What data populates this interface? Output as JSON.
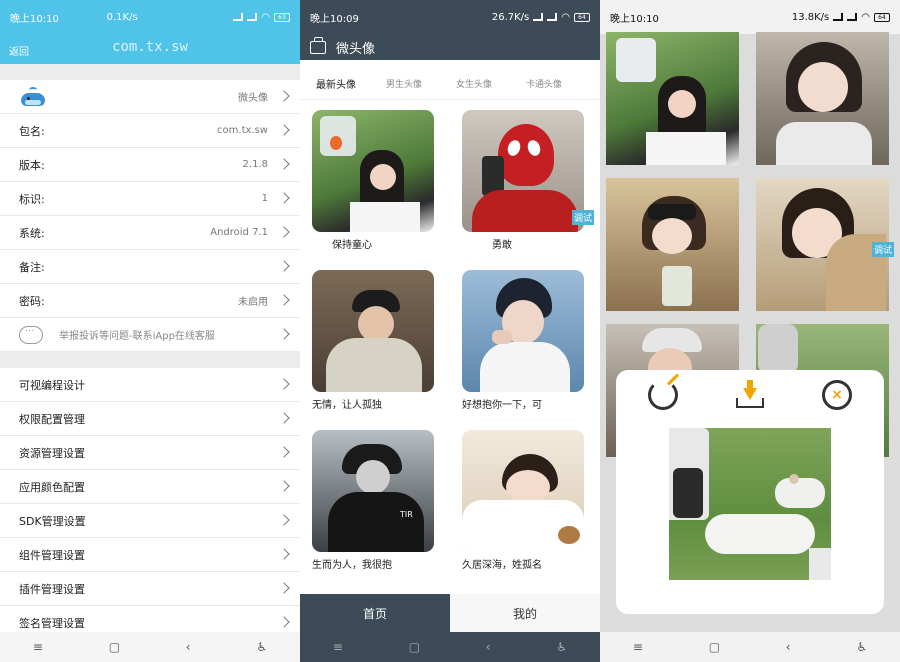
{
  "panel1": {
    "status": {
      "time": "晚上10:10",
      "speed": "0.1K/s",
      "battery": "63"
    },
    "back_label": "返回",
    "app_title": "com.tx.sw",
    "info_rows": [
      {
        "label": "",
        "value": "微头像",
        "icon": "whale-icon"
      },
      {
        "label": "包名:",
        "value": "com.tx.sw"
      },
      {
        "label": "版本:",
        "value": "2.1.8"
      },
      {
        "label": "标识:",
        "value": "1"
      },
      {
        "label": "系统:",
        "value": "Android 7.1"
      },
      {
        "label": "备注:",
        "value": ""
      },
      {
        "label": "密码:",
        "value": "未启用"
      }
    ],
    "complaint_text": "举报投诉等问题-联系iApp在线客服",
    "menu_rows": [
      "可视编程设计",
      "权限配置管理",
      "资源管理设置",
      "应用颜色配置",
      "SDK管理设置",
      "组件管理设置",
      "插件管理设置",
      "签名管理设置"
    ]
  },
  "panel2": {
    "status": {
      "time": "晚上10:09",
      "speed": "26.7K/s",
      "battery": "64"
    },
    "title": "微头像",
    "tabs": [
      "最新头像",
      "男生头像",
      "女生头像",
      "卡通头像"
    ],
    "cards": [
      {
        "caption": "保持童心"
      },
      {
        "caption": "勇敢"
      },
      {
        "caption": "无情，让人孤独"
      },
      {
        "caption": "好想抱你一下，可"
      },
      {
        "caption": "生而为人，我很抱"
      },
      {
        "caption": "久居深海，姓孤名"
      }
    ],
    "debug_label": "调试",
    "bottom_tabs": [
      "首页",
      "我的"
    ]
  },
  "panel3": {
    "status": {
      "time": "晚上10:10",
      "speed": "13.8K/s",
      "battery": "64"
    },
    "debug_label": "调试"
  },
  "navbar": {
    "menu": "≡",
    "home": "▢",
    "back": "‹",
    "accessibility": "♿"
  },
  "colors": {
    "blue_header": "#4fc3e8",
    "dark_header": "#3c4b57",
    "accent": "#f0a500"
  }
}
